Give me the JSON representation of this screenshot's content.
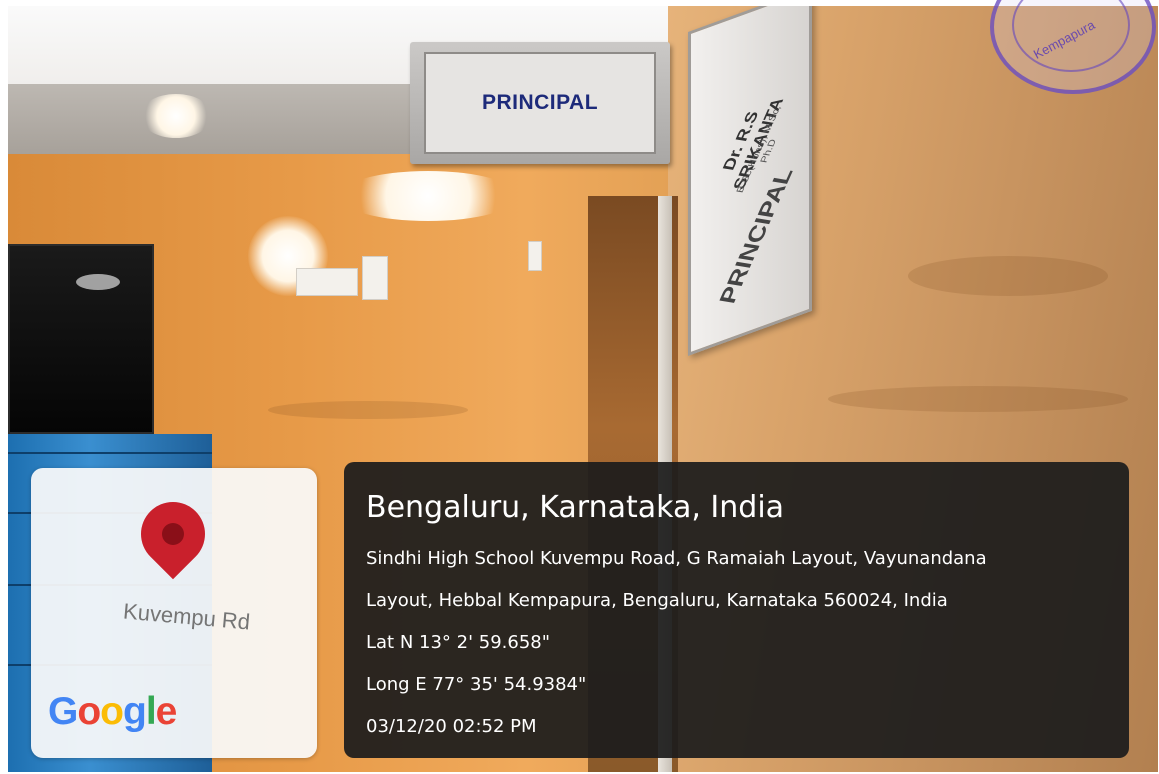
{
  "signs": {
    "door_sign": "PRINCIPAL",
    "side_sign": {
      "name": "Dr. R.S SRIKANTA",
      "qualification": "B.Sc(Hons), M.Sc, Ph.D",
      "title": "PRINCIPAL"
    },
    "stamp_text": "Kempapura"
  },
  "map_card": {
    "road_label": "Kuvempu Rd",
    "logo_text": "Google",
    "pin_icon": "map-pin-icon",
    "pin_color": "#c9202c"
  },
  "geo_info": {
    "city_line": "Bengaluru, Karnataka, India",
    "address_line1": "Sindhi High School Kuvempu Road, G Ramaiah Layout, Vayunandana",
    "address_line2": "Layout, Hebbal Kempapura, Bengaluru, Karnataka 560024, India",
    "latitude": "Lat N 13° 2' 59.658\"",
    "longitude": "Long E 77° 35' 54.9384\"",
    "timestamp": "03/12/20 02:52 PM"
  }
}
